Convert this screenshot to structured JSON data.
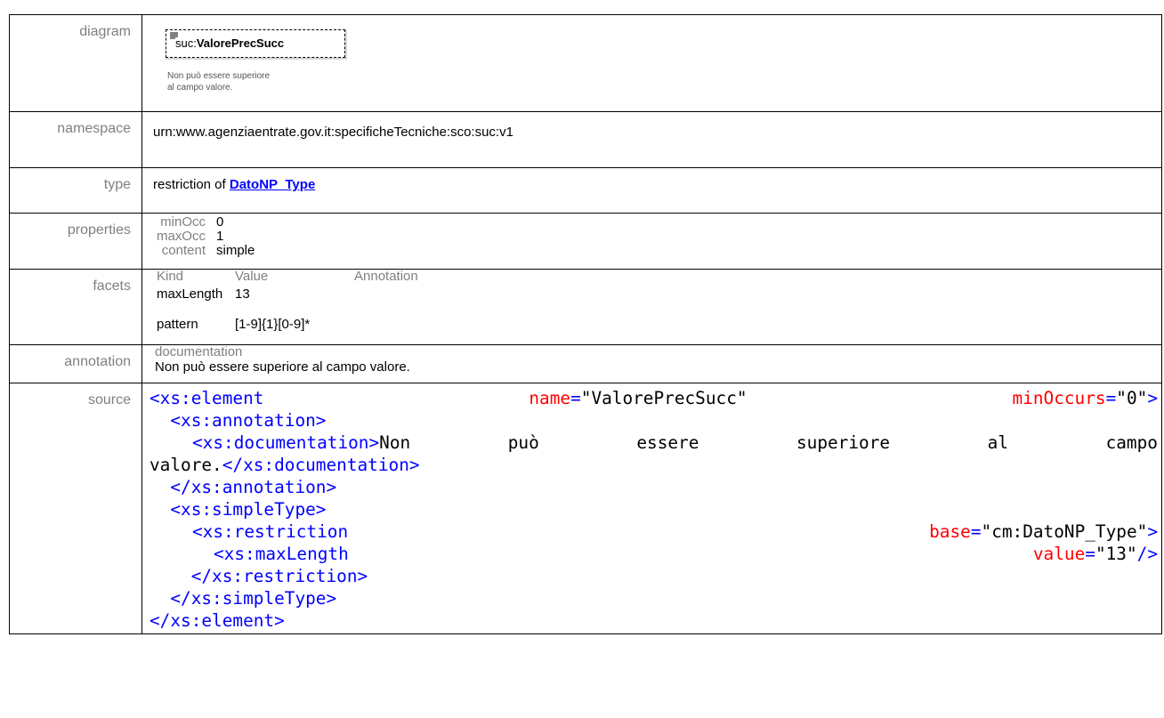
{
  "rows": {
    "diagram": {
      "label": "diagram",
      "element_prefix": "suc:",
      "element_name": "ValorePrecSucc",
      "note": "Non può essere superiore al campo valore."
    },
    "namespace": {
      "label": "namespace",
      "value": "urn:www.agenziaentrate.gov.it:specificheTecniche:sco:suc:v1"
    },
    "type": {
      "label": "type",
      "prefix": "restriction of",
      "link": "DatoNP_Type"
    },
    "properties": {
      "label": "properties",
      "items": [
        {
          "key": "minOcc",
          "value": "0"
        },
        {
          "key": "maxOcc",
          "value": "1"
        },
        {
          "key": "content",
          "value": "simple"
        }
      ]
    },
    "facets": {
      "label": "facets",
      "headers": [
        "Kind",
        "Value",
        "Annotation"
      ],
      "items": [
        {
          "kind": "maxLength",
          "value": "13"
        },
        {
          "kind": "pattern",
          "value": "[1-9]{1}[0-9]*"
        }
      ]
    },
    "annotation": {
      "label": "annotation",
      "title": "documentation",
      "text": "Non può essere superiore al campo valore."
    },
    "source": {
      "label": "source",
      "l1_open": "<xs:element",
      "l1_attr1_name": "name",
      "l1_attr1_val": "\"ValorePrecSucc\"",
      "l1_attr2_name": "minOccurs",
      "l1_attr2_val": "\"0\"",
      "l1_close": ">",
      "l2": "<xs:annotation>",
      "l3_open": "<xs:documentation>",
      "l3_words": [
        "Non",
        "può",
        "essere",
        "superiore",
        "al",
        "campo"
      ],
      "l4_text": "valore.",
      "l4_close": "</xs:documentation>",
      "l5": "</xs:annotation>",
      "l6": "<xs:simpleType>",
      "l7_open": "<xs:restriction",
      "l7_attr_name": "base",
      "l7_attr_val": "\"cm:DatoNP_Type\"",
      "l7_close": ">",
      "l8_open": "<xs:maxLength",
      "l8_attr_name": "value",
      "l8_attr_val": "\"13\"",
      "l8_close": "/>",
      "l9": "</xs:restriction>",
      "l10": "</xs:simpleType>",
      "l11": "</xs:element>"
    }
  }
}
